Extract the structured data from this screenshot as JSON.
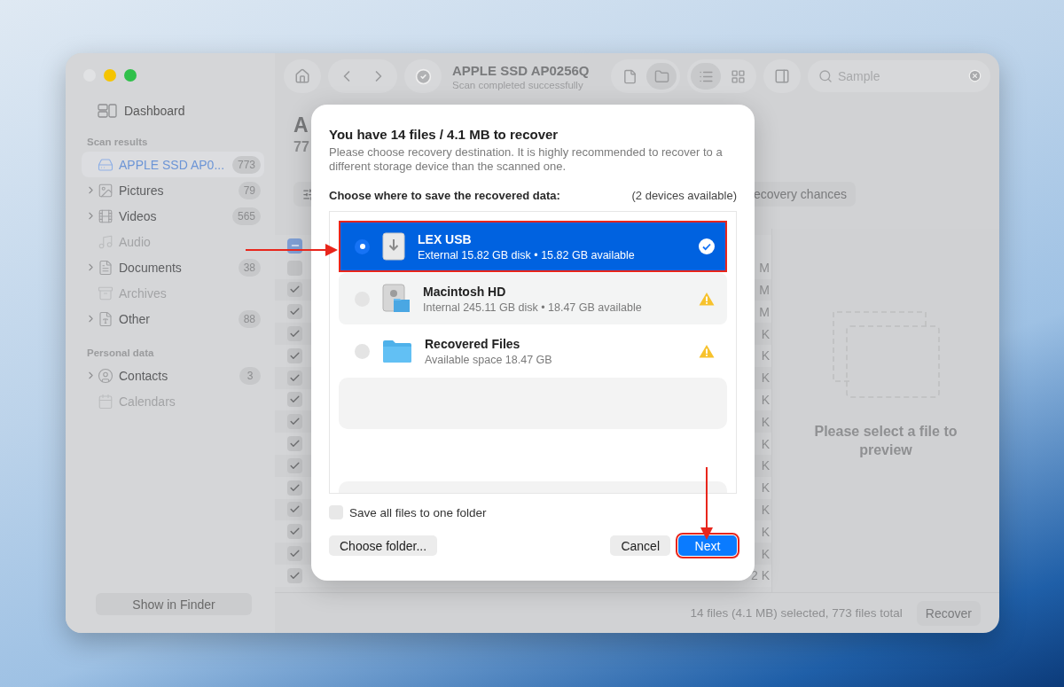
{
  "window": {
    "title": "APPLE SSD AP0256Q",
    "subtitle": "Scan completed successfully"
  },
  "toolbar": {
    "view_buttons": [
      {
        "kind": "file",
        "selected": false
      },
      {
        "kind": "folder",
        "selected": true
      }
    ],
    "layout_buttons": [
      {
        "kind": "list",
        "selected": true
      },
      {
        "kind": "grid",
        "selected": false
      }
    ],
    "search": {
      "placeholder": "Sample"
    }
  },
  "sidebar": {
    "dashboard": "Dashboard",
    "sections": [
      {
        "heading": "Scan results",
        "items": [
          {
            "kind": "drive",
            "label": "APPLE SSD AP0...",
            "count": "773",
            "selected": true,
            "expandable": false,
            "disabled": false
          },
          {
            "kind": "pictures",
            "label": "Pictures",
            "count": "79",
            "selected": false,
            "expandable": true,
            "disabled": false
          },
          {
            "kind": "videos",
            "label": "Videos",
            "count": "565",
            "selected": false,
            "expandable": true,
            "disabled": false
          },
          {
            "kind": "audio",
            "label": "Audio",
            "selected": false,
            "expandable": false,
            "disabled": true
          },
          {
            "kind": "documents",
            "label": "Documents",
            "count": "38",
            "selected": false,
            "expandable": true,
            "disabled": false
          },
          {
            "kind": "archives",
            "label": "Archives",
            "selected": false,
            "expandable": false,
            "disabled": true
          },
          {
            "kind": "other",
            "label": "Other",
            "count": "88",
            "selected": false,
            "expandable": true,
            "disabled": false
          }
        ]
      },
      {
        "heading": "Personal data",
        "items": [
          {
            "kind": "contacts",
            "label": "Contacts",
            "count": "3",
            "selected": false,
            "expandable": true,
            "disabled": false
          },
          {
            "kind": "calendars",
            "label": "Calendars",
            "selected": false,
            "expandable": false,
            "disabled": true
          }
        ]
      }
    ],
    "show_in_finder": "Show in Finder"
  },
  "content": {
    "title": "A",
    "subtitle": "77",
    "chances_button": "ecovery chances",
    "select_all_partial": true,
    "rows": [
      {
        "checked": false,
        "size": "M"
      },
      {
        "checked": true,
        "size": "M"
      },
      {
        "checked": true,
        "size": "M"
      },
      {
        "checked": true,
        "size": "K"
      },
      {
        "checked": true,
        "size": "K"
      },
      {
        "checked": true,
        "size": "K"
      },
      {
        "checked": true,
        "size": "K"
      },
      {
        "checked": true,
        "size": "K"
      },
      {
        "checked": true,
        "size": "K"
      },
      {
        "checked": true,
        "size": "K"
      },
      {
        "checked": true,
        "size": "K"
      },
      {
        "checked": true,
        "size": "K"
      },
      {
        "checked": true,
        "size": "K"
      },
      {
        "checked": true,
        "size": "K"
      },
      {
        "checked": true,
        "size": "2 K"
      }
    ]
  },
  "preview": {
    "message": "Please select a file to preview"
  },
  "status_bar": {
    "summary": "14 files (4.1 MB) selected, 773 files total",
    "button": "Recover"
  },
  "dialog": {
    "title": "You have 14 files / 4.1 MB to recover",
    "description": "Please choose recovery destination. It is highly recommended to recover to a different storage device than the scanned one.",
    "prompt": "Choose where to save the recovered data:",
    "available": "(2 devices available)",
    "devices": [
      {
        "kind": "usb",
        "name": "LEX USB",
        "detail": "External 15.82 GB disk • 15.82 GB available",
        "selected": true,
        "warning": false,
        "highlighted": true
      },
      {
        "kind": "hd",
        "name": "Macintosh HD",
        "detail": "Internal 245.11 GB disk • 18.47 GB available",
        "selected": false,
        "warning": true,
        "highlighted": false
      },
      {
        "kind": "folder",
        "name": "Recovered Files",
        "detail": "Available space 18.47 GB",
        "selected": false,
        "warning": true,
        "highlighted": false
      }
    ],
    "one_folder": {
      "label": "Save all files to one folder",
      "checked": false
    },
    "buttons": [
      {
        "kind": "secondary",
        "label": "Choose folder...",
        "highlighted": false
      },
      {
        "kind": "secondary",
        "label": "Cancel",
        "highlighted": false
      },
      {
        "kind": "primary",
        "label": "Next",
        "highlighted": true
      }
    ]
  }
}
